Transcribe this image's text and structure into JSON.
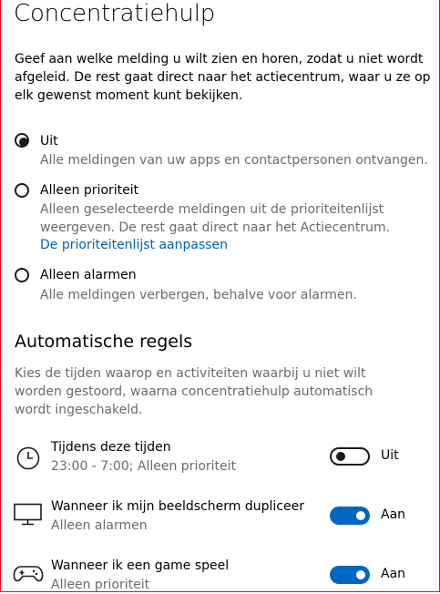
{
  "page": {
    "title": "Concentratiehulp",
    "intro": "Geef aan welke melding u wilt zien en horen, zodat u niet wordt afgeleid. De rest gaat direct naar het actiecentrum, waar u ze op elk gewenst moment kunt bekijken."
  },
  "options": [
    {
      "label": "Uit",
      "desc": "Alle meldingen van uw apps en contactpersonen ontvangen.",
      "selected": true
    },
    {
      "label": "Alleen prioriteit",
      "desc": "Alleen geselecteerde meldingen uit de prioriteitenlijst weergeven. De rest gaat direct naar het Actiecentrum.",
      "link": "De prioriteitenlijst aanpassen",
      "selected": false
    },
    {
      "label": "Alleen alarmen",
      "desc": "Alle meldingen verbergen, behalve voor alarmen.",
      "selected": false
    }
  ],
  "rules": {
    "heading": "Automatische regels",
    "desc": "Kies de tijden waarop en activiteiten waarbij u niet wilt worden gestoord, waarna concentratiehulp automatisch wordt ingeschakeld.",
    "items": [
      {
        "icon": "clock-icon",
        "title": "Tijdens deze tijden",
        "detail": "23:00 - 7:00; Alleen prioriteit",
        "state": "Uit",
        "on": false
      },
      {
        "icon": "monitor-icon",
        "title": "Wanneer ik mijn beeldscherm dupliceer",
        "detail": "Alleen alarmen",
        "state": "Aan",
        "on": true
      },
      {
        "icon": "gamepad-icon",
        "title": "Wanneer ik een game speel",
        "detail": "Alleen prioriteit",
        "state": "Aan",
        "on": true
      }
    ]
  },
  "colors": {
    "accent": "#0067c0",
    "link": "#0063b1",
    "secondary_text": "#6b6b6b",
    "frame": "#e81123"
  }
}
